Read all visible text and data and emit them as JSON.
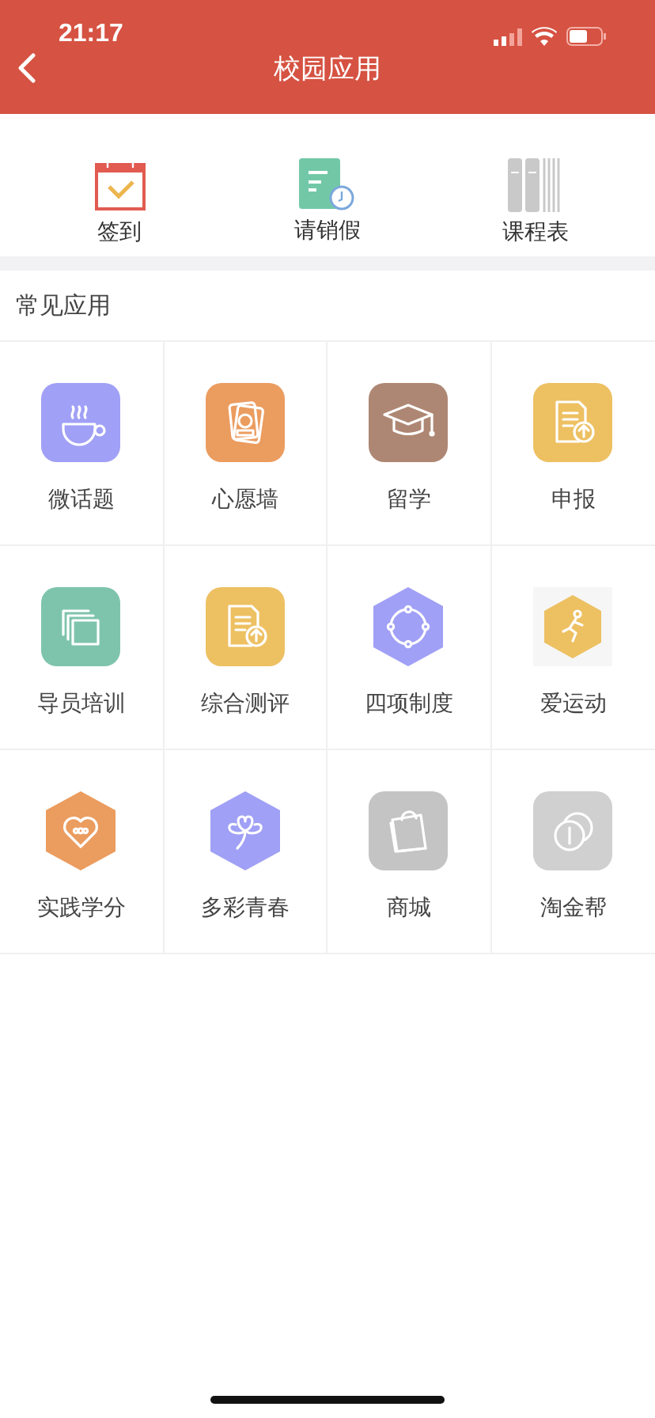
{
  "status_bar": {
    "time": "21:17"
  },
  "header": {
    "title": "校园应用"
  },
  "quick_actions": [
    {
      "label": "签到"
    },
    {
      "label": "请销假"
    },
    {
      "label": "课程表"
    }
  ],
  "section": {
    "title": "常见应用"
  },
  "apps": [
    {
      "label": "微话题",
      "kind": "square",
      "color": "#a0a0f6"
    },
    {
      "label": "心愿墙",
      "kind": "square",
      "color": "#eb9c5f"
    },
    {
      "label": "留学",
      "kind": "square",
      "color": "#ae8774"
    },
    {
      "label": "申报",
      "kind": "square",
      "color": "#edc062"
    },
    {
      "label": "导员培训",
      "kind": "square",
      "color": "#7ec4ac"
    },
    {
      "label": "综合测评",
      "kind": "square",
      "color": "#edc062"
    },
    {
      "label": "四项制度",
      "kind": "hexagon",
      "color": "#a0a0f6"
    },
    {
      "label": "爱运动",
      "kind": "framed-hexagon",
      "color": "#edc062"
    },
    {
      "label": "实践学分",
      "kind": "hexagon",
      "color": "#eb9c5f"
    },
    {
      "label": "多彩青春",
      "kind": "hexagon",
      "color": "#a0a0f6"
    },
    {
      "label": "商城",
      "kind": "square",
      "color": "#c4c4c4"
    },
    {
      "label": "淘金帮",
      "kind": "square",
      "color": "#d0d0d0"
    }
  ]
}
